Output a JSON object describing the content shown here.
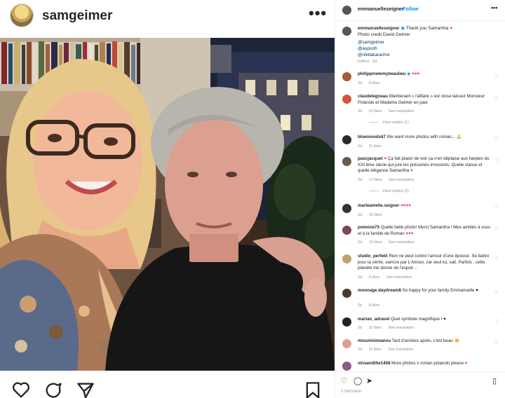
{
  "post": {
    "username": "samgeimer",
    "more_icon": "more-horizontal-icon"
  },
  "side": {
    "username": "emmanuelleseigner",
    "follow": "• Follow",
    "caption": {
      "line1_user": "emmanuelleseigner",
      "line1_text": "Thank you Samantha",
      "line2": "Photo credit David Geimer",
      "mention1": "@samgeimer",
      "mention2": "@asproth",
      "mention3": "@nikitakarachoi",
      "meta": "Edited · 2d"
    },
    "comments": [
      {
        "user": "philippinelemybeaulieu",
        "text": "",
        "hearts": "♥♥♥",
        "meta": [
          "2d",
          "6 likes"
        ],
        "avatar": "#a85a3a"
      },
      {
        "user": "claudelegneau",
        "text": "Maintenant « l'affaire » est close laissez Monsieur Polanski et Madame Geimer en paix",
        "meta": [
          "2d",
          "22 likes",
          "See translation"
        ],
        "avatar": "#d4553a"
      },
      {
        "user": "bluemoods67",
        "text": "We want more photos with roman...",
        "meta": [
          "2d",
          "11 likes"
        ],
        "avatar": "#2a2a2a"
      },
      {
        "user": "pascjacquet",
        "text": "Ça fait plaisir de voir ça n'en déplaise aux harpies du XXI ème siècle qui jure les présumés innocents. Quelle classe et quelle élégance Samantha",
        "meta": [
          "2d",
          "17 likes",
          "See translation"
        ],
        "avatar": "#6a5a4a"
      },
      {
        "user": "marleamelie.seigner",
        "text": "",
        "hearts": "♥♥♥♥",
        "meta": [
          "2d",
          "16 likes"
        ],
        "avatar": "#333333"
      },
      {
        "user": "pomone75",
        "text": "Quelle belle photo! Merci Samantha ! Mes amitiés à vous et à la famille de Roman",
        "meta": [
          "2d",
          "15 likes",
          "See translation"
        ],
        "avatar": "#7a4a5a"
      },
      {
        "user": "studio_perfekt",
        "text": "Rien ne peut contre l'amour d'une épouse. Se battre pour la vérité, vaincre par L'Amour, car seul lui, sait. Parfois , cette planète me donne de l'espoir...",
        "meta": [
          "2d",
          "9 likes",
          "See translation"
        ],
        "avatar": "#c4a070"
      },
      {
        "user": "moonage.daydream8",
        "text": "So happy for your family Emmanuelle",
        "meta": [
          "2d",
          "8 likes"
        ],
        "avatar": "#4a3a2a"
      },
      {
        "user": "marian_adravel",
        "text": "Quel symbole magnifique !",
        "meta": [
          "2d",
          "11 likes",
          "See translation"
        ],
        "avatar": "#222222"
      },
      {
        "user": "missminimanou",
        "text": "Tant d'années après, c'est beau",
        "meta": [
          "2d",
          "11 likes",
          "See translation"
        ],
        "avatar": "#e0a090"
      },
      {
        "user": "xinsandthe1408",
        "text": "More photos v roman polanski please",
        "meta": [],
        "avatar": "#8a5a8a"
      }
    ],
    "view_replies_1": "View replies (1)",
    "view_replies_2": "View replies (3)",
    "date": "2 DAYS AGO"
  },
  "colors": {
    "accent": "#0095f6",
    "heart": "#ed4956",
    "muted": "#8e8e8e"
  }
}
